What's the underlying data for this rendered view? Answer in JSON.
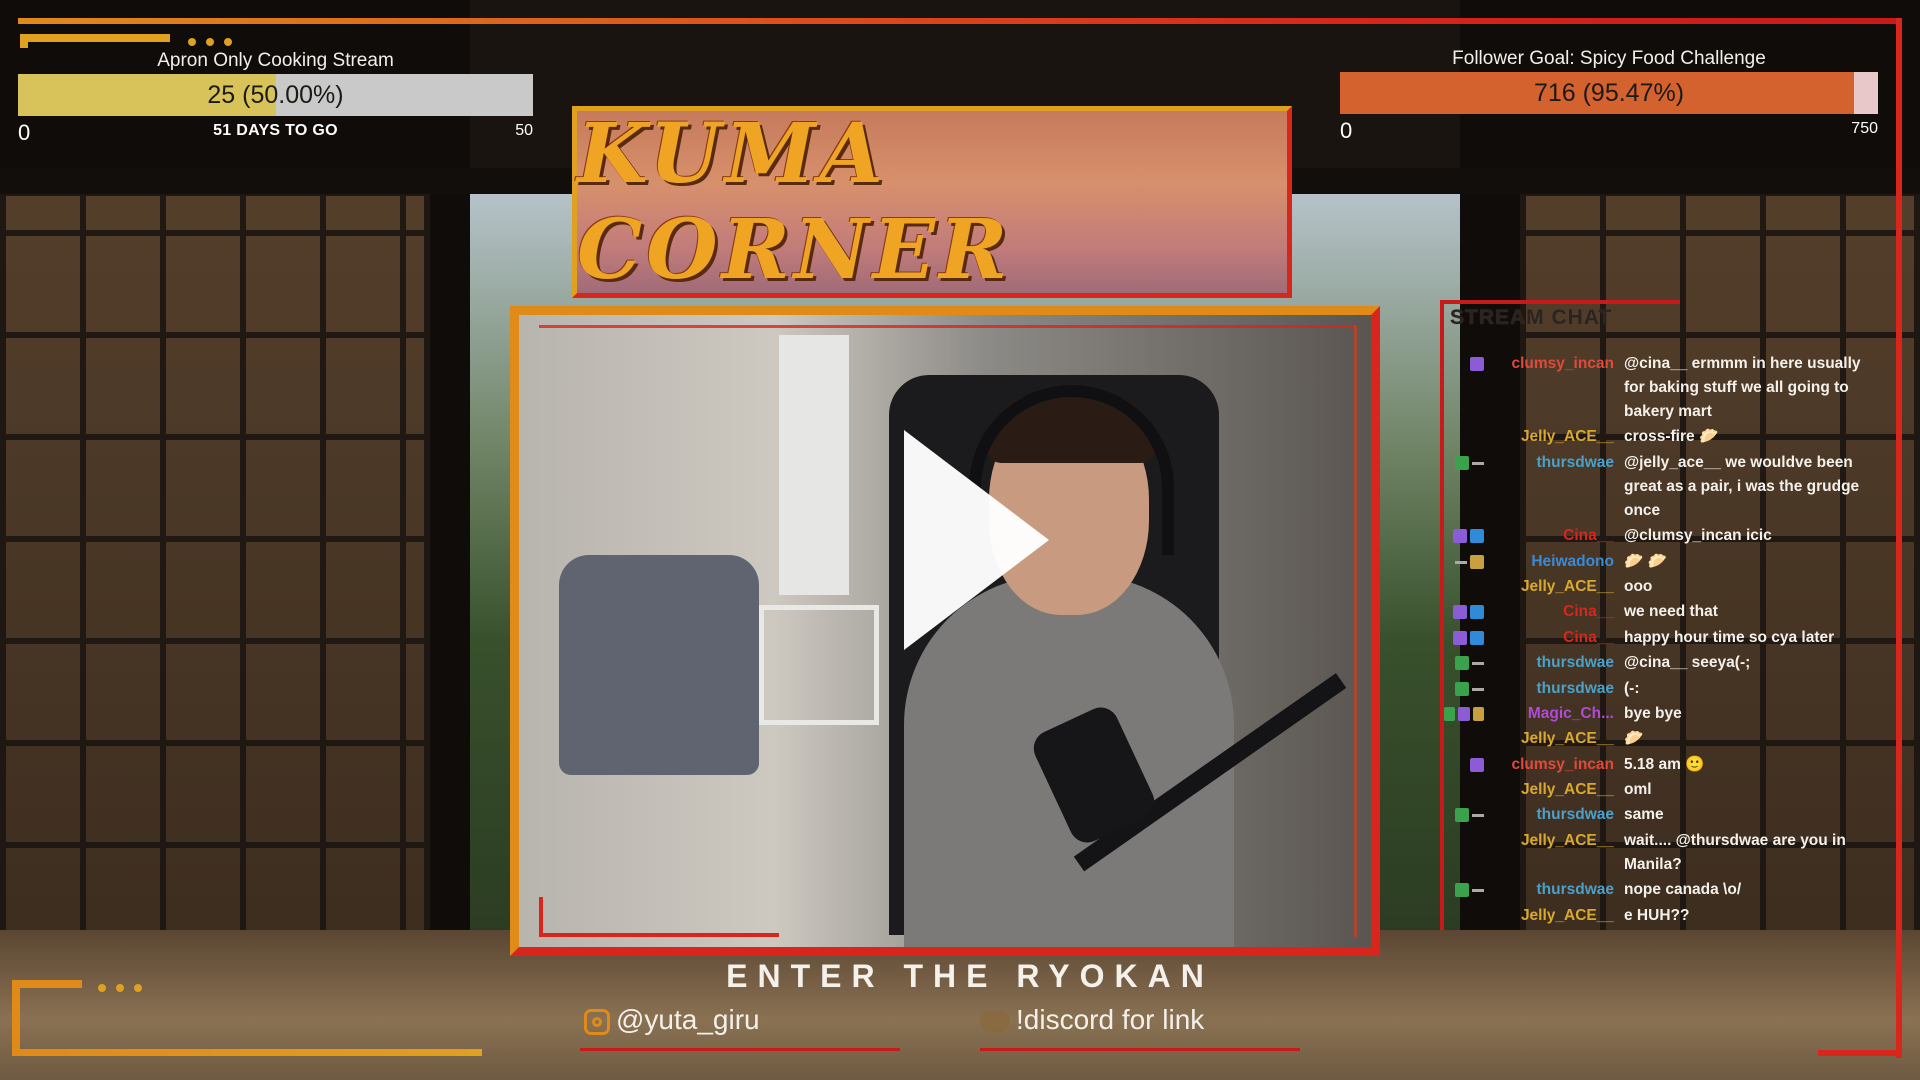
{
  "goal_left": {
    "title": "Apron Only Cooking Stream",
    "progress_text": "25 (50.00%)",
    "current": 25,
    "target": 50,
    "fraction": 0.5,
    "min_label": "0",
    "max_label": "50",
    "subtitle": "51 DAYS TO GO",
    "fill_color": "#d8c35a"
  },
  "goal_right": {
    "title": "Follower Goal: Spicy Food Challenge",
    "progress_text": "716 (95.47%)",
    "current": 716,
    "target": 750,
    "fraction": 0.9547,
    "min_label": "0",
    "max_label": "750",
    "fill_color": "#d4622e"
  },
  "banner": {
    "title": "KUMA CORNER"
  },
  "webcam": {
    "play_icon": "play-icon"
  },
  "chat": {
    "title": "STREAM CHAT",
    "messages": [
      {
        "badges": [
          "purple"
        ],
        "user": "clumsy_incan",
        "color": "#e04a3a",
        "text": "@cina__ ermmm in here usually for baking stuff we all going to bakery mart"
      },
      {
        "badges": [],
        "user": "Jelly_ACE__",
        "color": "#d8a830",
        "text": "cross-fire 🥟"
      },
      {
        "badges": [
          "green",
          "dash"
        ],
        "user": "thursdwae",
        "color": "#4aa0c8",
        "text": "@jelly_ace__ we wouldve been great as a pair, i was the grudge once"
      },
      {
        "badges": [
          "purple",
          "blue"
        ],
        "user": "Cina__",
        "color": "#d8261c",
        "text": "@clumsy_incan icic"
      },
      {
        "badges": [
          "dash",
          "gold"
        ],
        "user": "Heiwadono",
        "color": "#3a8ad8",
        "text": "🥟 🥟"
      },
      {
        "badges": [],
        "user": "Jelly_ACE__",
        "color": "#d8a830",
        "text": "ooo"
      },
      {
        "badges": [
          "purple",
          "blue"
        ],
        "user": "Cina__",
        "color": "#d8261c",
        "text": "we need that"
      },
      {
        "badges": [
          "purple",
          "blue"
        ],
        "user": "Cina__",
        "color": "#d8261c",
        "text": "happy hour time so cya later"
      },
      {
        "badges": [
          "green",
          "dash"
        ],
        "user": "thursdwae",
        "color": "#4aa0c8",
        "text": "@cina__ seeya(-;"
      },
      {
        "badges": [
          "green",
          "dash"
        ],
        "user": "thursdwae",
        "color": "#4aa0c8",
        "text": "(-:"
      },
      {
        "badges": [
          "green",
          "purple",
          "gold"
        ],
        "user": "Magic_Ch...",
        "color": "#b04ad8",
        "text": "bye bye"
      },
      {
        "badges": [],
        "user": "Jelly_ACE__",
        "color": "#d8a830",
        "text": "🥟"
      },
      {
        "badges": [
          "purple"
        ],
        "user": "clumsy_incan",
        "color": "#e04a3a",
        "text": "5.18 am 🙂"
      },
      {
        "badges": [],
        "user": "Jelly_ACE__",
        "color": "#d8a830",
        "text": "oml"
      },
      {
        "badges": [
          "green",
          "dash"
        ],
        "user": "thursdwae",
        "color": "#4aa0c8",
        "text": "same"
      },
      {
        "badges": [],
        "user": "Jelly_ACE__",
        "color": "#d8a830",
        "text": "wait.... @thursdwae are you in Manila?"
      },
      {
        "badges": [
          "green",
          "dash"
        ],
        "user": "thursdwae",
        "color": "#4aa0c8",
        "text": "nope canada \\o/"
      },
      {
        "badges": [],
        "user": "Jelly_ACE__",
        "color": "#d8a830",
        "text": "e HUH??"
      }
    ]
  },
  "footer": {
    "tagline": "ENTER THE RYOKAN",
    "instagram": "@yuta_giru",
    "instagram_icon": "instagram-icon",
    "discord": "!discord for link",
    "discord_icon": "discord-icon"
  },
  "colors": {
    "accent_orange": "#e08a1a",
    "accent_red": "#d8261c",
    "accent_gold": "#e0a020"
  }
}
